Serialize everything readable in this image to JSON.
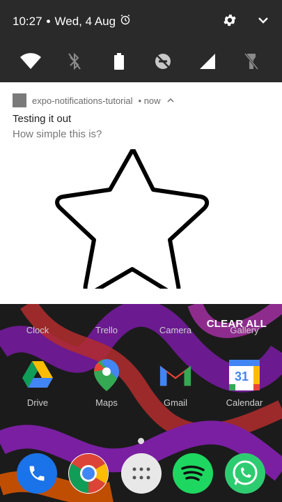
{
  "status": {
    "time": "10:27",
    "separator": "•",
    "date": "Wed, 4 Aug"
  },
  "quick_settings": {
    "tiles": [
      {
        "icon": "wifi-icon"
      },
      {
        "icon": "bluetooth-icon"
      },
      {
        "icon": "battery-icon"
      },
      {
        "icon": "do-not-disturb-icon"
      },
      {
        "icon": "cellular-signal-icon"
      },
      {
        "icon": "flashlight-off-icon"
      }
    ]
  },
  "notification": {
    "app_name": "expo-notifications-tutorial",
    "time": "• now",
    "title": "Testing it out",
    "text": "How simple this is?",
    "image": "star-outline"
  },
  "home": {
    "clear_all": "CLEAR ALL",
    "row1": [
      "Clock",
      "Trello",
      "Camera",
      "Gallery"
    ],
    "row2": [
      "Drive",
      "Maps",
      "Gmail",
      "Calendar"
    ],
    "calendar_day": "31",
    "dock": [
      "phone-icon",
      "chrome-icon",
      "app-drawer-icon",
      "spotify-icon",
      "whatsapp-icon"
    ]
  },
  "colors": {
    "shade": "#2a2a2a",
    "card": "#ffffff",
    "muted_text": "#777777",
    "wallpaper_purple": "#7a1fa2",
    "wallpaper_red": "#c0392b"
  }
}
